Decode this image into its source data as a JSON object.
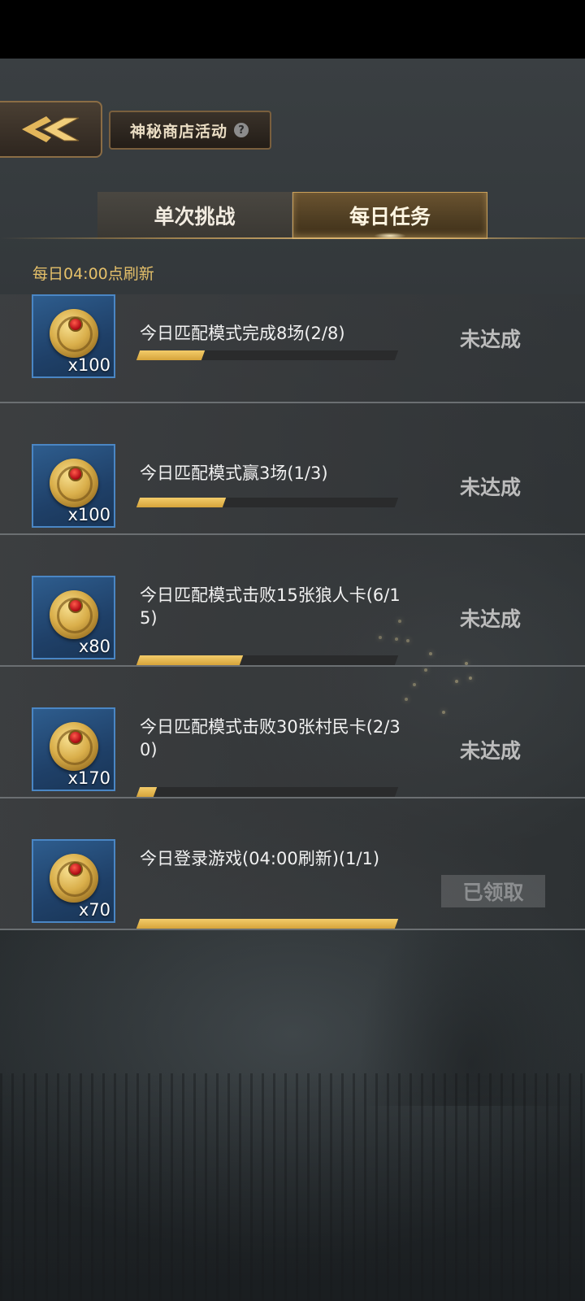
{
  "header": {
    "title": "神秘商店活动",
    "help_glyph": "?"
  },
  "tabs": [
    {
      "label": "单次挑战",
      "active": false
    },
    {
      "label": "每日任务",
      "active": true
    }
  ],
  "refresh_note": "每日04:00点刷新",
  "tasks": [
    {
      "title": "今日匹配模式完成8场(2/8)",
      "reward_qty": "x100",
      "progress": 0.25,
      "status": "未达成"
    },
    {
      "title": "今日匹配模式赢3场(1/3)",
      "reward_qty": "x100",
      "progress": 0.333,
      "status": "未达成"
    },
    {
      "title": "今日匹配模式击败15张狼人卡(6/15)",
      "reward_qty": "x80",
      "progress": 0.4,
      "status": "未达成"
    },
    {
      "title": "今日匹配模式击败30张村民卡(2/30)",
      "reward_qty": "x170",
      "progress": 0.067,
      "status": "未达成"
    },
    {
      "title": "今日登录游戏(04:00刷新)(1/1)",
      "reward_qty": "x70",
      "progress": 1.0,
      "status": "已领取"
    }
  ],
  "colors": {
    "accent_gold": "#e5c06a",
    "progress_fill": "#d6a43b",
    "reward_bg": "#1f4068"
  },
  "icons": {
    "back": "back-arrow-icon",
    "help": "help-icon",
    "reward": "gold-coin-icon"
  }
}
